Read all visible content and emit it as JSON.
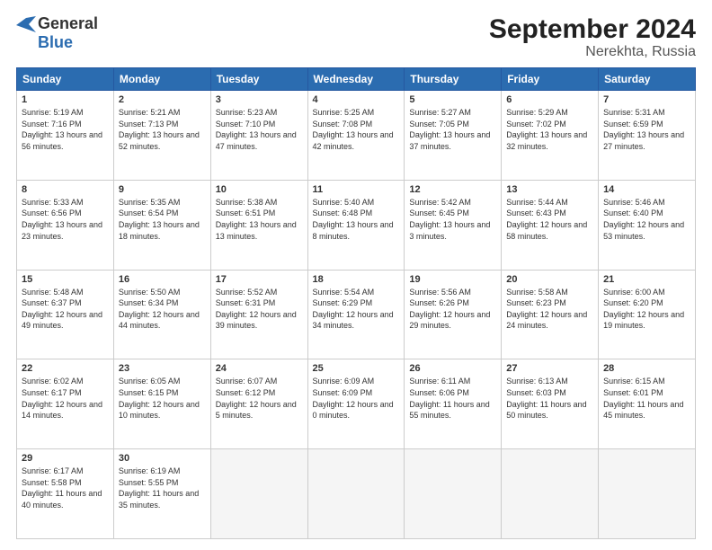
{
  "logo": {
    "line1": "General",
    "line2": "Blue"
  },
  "title": "September 2024",
  "subtitle": "Nerekhta, Russia",
  "days_header": [
    "Sunday",
    "Monday",
    "Tuesday",
    "Wednesday",
    "Thursday",
    "Friday",
    "Saturday"
  ],
  "weeks": [
    [
      {
        "num": "1",
        "sunrise": "Sunrise: 5:19 AM",
        "sunset": "Sunset: 7:16 PM",
        "daylight": "Daylight: 13 hours and 56 minutes."
      },
      {
        "num": "2",
        "sunrise": "Sunrise: 5:21 AM",
        "sunset": "Sunset: 7:13 PM",
        "daylight": "Daylight: 13 hours and 52 minutes."
      },
      {
        "num": "3",
        "sunrise": "Sunrise: 5:23 AM",
        "sunset": "Sunset: 7:10 PM",
        "daylight": "Daylight: 13 hours and 47 minutes."
      },
      {
        "num": "4",
        "sunrise": "Sunrise: 5:25 AM",
        "sunset": "Sunset: 7:08 PM",
        "daylight": "Daylight: 13 hours and 42 minutes."
      },
      {
        "num": "5",
        "sunrise": "Sunrise: 5:27 AM",
        "sunset": "Sunset: 7:05 PM",
        "daylight": "Daylight: 13 hours and 37 minutes."
      },
      {
        "num": "6",
        "sunrise": "Sunrise: 5:29 AM",
        "sunset": "Sunset: 7:02 PM",
        "daylight": "Daylight: 13 hours and 32 minutes."
      },
      {
        "num": "7",
        "sunrise": "Sunrise: 5:31 AM",
        "sunset": "Sunset: 6:59 PM",
        "daylight": "Daylight: 13 hours and 27 minutes."
      }
    ],
    [
      {
        "num": "8",
        "sunrise": "Sunrise: 5:33 AM",
        "sunset": "Sunset: 6:56 PM",
        "daylight": "Daylight: 13 hours and 23 minutes."
      },
      {
        "num": "9",
        "sunrise": "Sunrise: 5:35 AM",
        "sunset": "Sunset: 6:54 PM",
        "daylight": "Daylight: 13 hours and 18 minutes."
      },
      {
        "num": "10",
        "sunrise": "Sunrise: 5:38 AM",
        "sunset": "Sunset: 6:51 PM",
        "daylight": "Daylight: 13 hours and 13 minutes."
      },
      {
        "num": "11",
        "sunrise": "Sunrise: 5:40 AM",
        "sunset": "Sunset: 6:48 PM",
        "daylight": "Daylight: 13 hours and 8 minutes."
      },
      {
        "num": "12",
        "sunrise": "Sunrise: 5:42 AM",
        "sunset": "Sunset: 6:45 PM",
        "daylight": "Daylight: 13 hours and 3 minutes."
      },
      {
        "num": "13",
        "sunrise": "Sunrise: 5:44 AM",
        "sunset": "Sunset: 6:43 PM",
        "daylight": "Daylight: 12 hours and 58 minutes."
      },
      {
        "num": "14",
        "sunrise": "Sunrise: 5:46 AM",
        "sunset": "Sunset: 6:40 PM",
        "daylight": "Daylight: 12 hours and 53 minutes."
      }
    ],
    [
      {
        "num": "15",
        "sunrise": "Sunrise: 5:48 AM",
        "sunset": "Sunset: 6:37 PM",
        "daylight": "Daylight: 12 hours and 49 minutes."
      },
      {
        "num": "16",
        "sunrise": "Sunrise: 5:50 AM",
        "sunset": "Sunset: 6:34 PM",
        "daylight": "Daylight: 12 hours and 44 minutes."
      },
      {
        "num": "17",
        "sunrise": "Sunrise: 5:52 AM",
        "sunset": "Sunset: 6:31 PM",
        "daylight": "Daylight: 12 hours and 39 minutes."
      },
      {
        "num": "18",
        "sunrise": "Sunrise: 5:54 AM",
        "sunset": "Sunset: 6:29 PM",
        "daylight": "Daylight: 12 hours and 34 minutes."
      },
      {
        "num": "19",
        "sunrise": "Sunrise: 5:56 AM",
        "sunset": "Sunset: 6:26 PM",
        "daylight": "Daylight: 12 hours and 29 minutes."
      },
      {
        "num": "20",
        "sunrise": "Sunrise: 5:58 AM",
        "sunset": "Sunset: 6:23 PM",
        "daylight": "Daylight: 12 hours and 24 minutes."
      },
      {
        "num": "21",
        "sunrise": "Sunrise: 6:00 AM",
        "sunset": "Sunset: 6:20 PM",
        "daylight": "Daylight: 12 hours and 19 minutes."
      }
    ],
    [
      {
        "num": "22",
        "sunrise": "Sunrise: 6:02 AM",
        "sunset": "Sunset: 6:17 PM",
        "daylight": "Daylight: 12 hours and 14 minutes."
      },
      {
        "num": "23",
        "sunrise": "Sunrise: 6:05 AM",
        "sunset": "Sunset: 6:15 PM",
        "daylight": "Daylight: 12 hours and 10 minutes."
      },
      {
        "num": "24",
        "sunrise": "Sunrise: 6:07 AM",
        "sunset": "Sunset: 6:12 PM",
        "daylight": "Daylight: 12 hours and 5 minutes."
      },
      {
        "num": "25",
        "sunrise": "Sunrise: 6:09 AM",
        "sunset": "Sunset: 6:09 PM",
        "daylight": "Daylight: 12 hours and 0 minutes."
      },
      {
        "num": "26",
        "sunrise": "Sunrise: 6:11 AM",
        "sunset": "Sunset: 6:06 PM",
        "daylight": "Daylight: 11 hours and 55 minutes."
      },
      {
        "num": "27",
        "sunrise": "Sunrise: 6:13 AM",
        "sunset": "Sunset: 6:03 PM",
        "daylight": "Daylight: 11 hours and 50 minutes."
      },
      {
        "num": "28",
        "sunrise": "Sunrise: 6:15 AM",
        "sunset": "Sunset: 6:01 PM",
        "daylight": "Daylight: 11 hours and 45 minutes."
      }
    ],
    [
      {
        "num": "29",
        "sunrise": "Sunrise: 6:17 AM",
        "sunset": "Sunset: 5:58 PM",
        "daylight": "Daylight: 11 hours and 40 minutes."
      },
      {
        "num": "30",
        "sunrise": "Sunrise: 6:19 AM",
        "sunset": "Sunset: 5:55 PM",
        "daylight": "Daylight: 11 hours and 35 minutes."
      },
      null,
      null,
      null,
      null,
      null
    ]
  ]
}
